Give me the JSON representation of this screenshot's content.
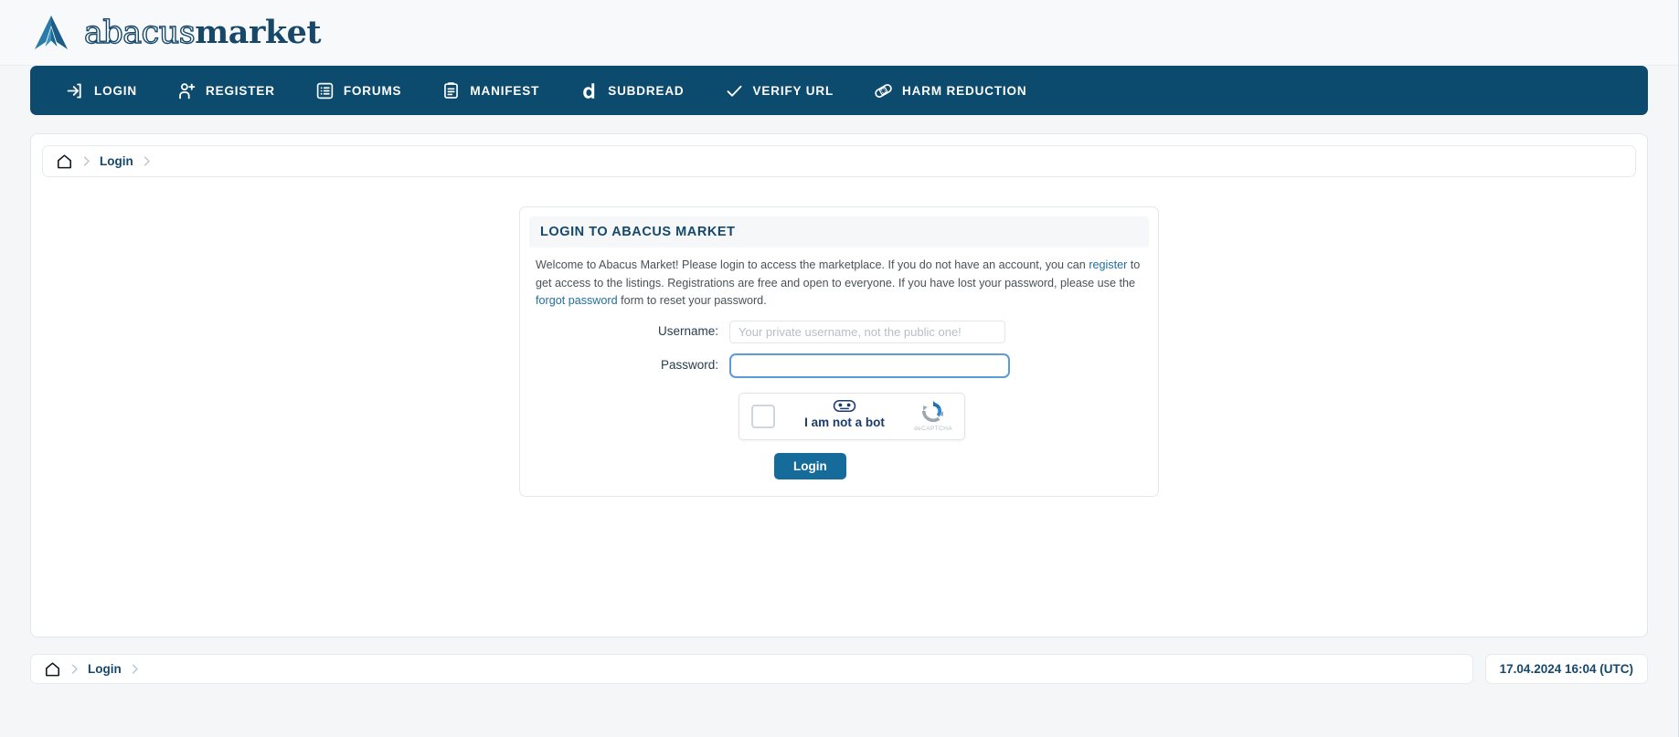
{
  "brand": {
    "logo_icon": "abacus-triangle-logo-icon",
    "name_light": "abacus",
    "name_bold": "market"
  },
  "nav": {
    "items": [
      {
        "label": "LOGIN",
        "icon": "login-arrow-icon"
      },
      {
        "label": "REGISTER",
        "icon": "user-plus-icon"
      },
      {
        "label": "FORUMS",
        "icon": "list-icon"
      },
      {
        "label": "MANIFEST",
        "icon": "clipboard-icon"
      },
      {
        "label": "SUBDREAD",
        "icon": "dread-d-icon"
      },
      {
        "label": "VERIFY URL",
        "icon": "check-icon"
      },
      {
        "label": "HARM REDUCTION",
        "icon": "bandage-icon"
      }
    ]
  },
  "breadcrumb": {
    "home_icon": "home-icon",
    "separator_icon": "chevron-right-icon",
    "current": "Login"
  },
  "login_card": {
    "heading": "LOGIN TO ABACUS MARKET",
    "intro_part1": "Welcome to Abacus Market! Please login to access the marketplace. If you do not have an account, you can ",
    "register_link": "register",
    "intro_part2": " to get access to the listings. Registrations are free and open to everyone. If you have lost your password, please use the ",
    "forgot_link": "forgot password",
    "intro_part3": " form to reset your password.",
    "username_label": "Username:",
    "username_placeholder": "Your private username, not the public one!",
    "username_value": "",
    "password_label": "Password:",
    "password_value": "",
    "submit_label": "Login"
  },
  "captcha": {
    "checkbox_icon": "captcha-checkbox",
    "robot_icon": "robot-face-icon",
    "label": "I am not a bot",
    "brand_icon": "recaptcha-refresh-icon",
    "brand_label": "deCAPTCHA"
  },
  "footer": {
    "timestamp": "17.04.2024 16:04 (UTC)"
  },
  "colors": {
    "nav_bg": "#0c4b6e",
    "accent": "#17486a",
    "button": "#156b9a",
    "link": "#1f6f9e",
    "focus_border": "#5a9bd8",
    "page_bg": "#f4f6f8"
  }
}
